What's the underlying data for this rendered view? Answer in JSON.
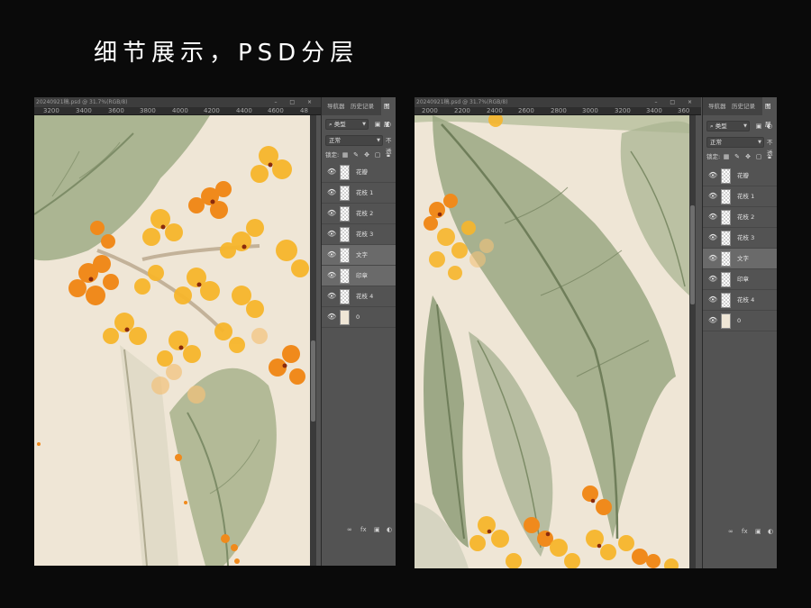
{
  "headline": "细节展示，PSD分层",
  "left": {
    "doc_title": "20240921稿.psd @ 31.7%(RGB/8)",
    "rulers": [
      "3200",
      "3400",
      "3600",
      "3800",
      "4000",
      "4200",
      "4400",
      "4600",
      "48"
    ]
  },
  "right": {
    "doc_title": "20240921稿.psd @ 31.7%(RGB/8)",
    "rulers": [
      "2000",
      "2200",
      "2400",
      "2600",
      "2800",
      "3000",
      "3200",
      "3400",
      "360"
    ]
  },
  "window_controls": "– □ ×",
  "panel": {
    "tabs": [
      "导航器",
      "历史记录",
      "图层"
    ],
    "filter_label": "类型",
    "blend_mode": "正常",
    "opacity_label": "不透",
    "lock_label": "锁定:",
    "layers_left": [
      {
        "name": "花瓣",
        "selected": false,
        "fill": false
      },
      {
        "name": "花枝 1",
        "selected": false,
        "fill": false
      },
      {
        "name": "花枝 2",
        "selected": false,
        "fill": false
      },
      {
        "name": "花枝 3",
        "selected": false,
        "fill": false
      },
      {
        "name": "文字",
        "selected": true,
        "fill": false
      },
      {
        "name": "印章",
        "selected": true,
        "fill": false
      },
      {
        "name": "花枝 4",
        "selected": false,
        "fill": false
      },
      {
        "name": "0",
        "selected": false,
        "fill": true
      }
    ],
    "layers_right": [
      {
        "name": "花瓣",
        "selected": false,
        "fill": false
      },
      {
        "name": "花枝 1",
        "selected": false,
        "fill": false
      },
      {
        "name": "花枝 2",
        "selected": false,
        "fill": false
      },
      {
        "name": "花枝 3",
        "selected": false,
        "fill": false
      },
      {
        "name": "文字",
        "selected": true,
        "fill": false
      },
      {
        "name": "印章",
        "selected": false,
        "fill": false
      },
      {
        "name": "花枝 4",
        "selected": false,
        "fill": false
      },
      {
        "name": "0",
        "selected": false,
        "fill": true
      }
    ],
    "footer_icons": [
      "∞",
      "fx",
      "▣",
      "◐"
    ]
  },
  "colors": {
    "paper": "#efe6d6",
    "leaf": "#9fab86",
    "leaf_dark": "#7d8c67",
    "petal_orange": "#f08a1c",
    "petal_yellow": "#f7b62c",
    "panel_bg": "#535353",
    "selected_row": "#6a6a6a"
  }
}
